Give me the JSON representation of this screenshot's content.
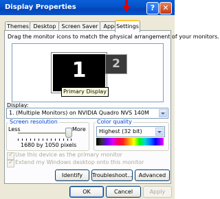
{
  "window": {
    "title": "Display Properties",
    "help_label": "?",
    "close_label": "✕"
  },
  "tabs": [
    {
      "label": "Themes"
    },
    {
      "label": "Desktop"
    },
    {
      "label": "Screen Saver"
    },
    {
      "label": "Appearance"
    },
    {
      "label": "Settings",
      "active": true
    }
  ],
  "settings": {
    "instruction": "Drag the monitor icons to match the physical arrangement of your monitors.",
    "monitors": [
      {
        "number": "1"
      },
      {
        "number": "2"
      }
    ],
    "tooltip": "Primary Display",
    "display_label": "Display:",
    "display_value": "1. (Multiple Monitors) on NVIDIA Quadro NVS 140M",
    "screen_resolution": {
      "title": "Screen resolution",
      "less_label": "Less",
      "more_label": "More",
      "value_text": "1680 by 1050 pixels"
    },
    "color_quality": {
      "title": "Color quality",
      "selected": "Highest (32 bit)"
    },
    "checkboxes": [
      {
        "label": "Use this device as the primary monitor",
        "checked": true,
        "enabled": false
      },
      {
        "label": "Extend my Windows desktop onto this monitor",
        "checked": true,
        "enabled": false
      }
    ],
    "buttons": {
      "identify": "Identify",
      "troubleshoot": "Troubleshoot...",
      "advanced": "Advanced"
    }
  },
  "dialog_buttons": {
    "ok": "OK",
    "cancel": "Cancel",
    "apply": "Apply"
  },
  "colors": {
    "titlebar": "#0453C7",
    "active_tab_accent": "#FFC83C",
    "annotation_arrow": "#E00000",
    "group_title": "#0046D5"
  }
}
